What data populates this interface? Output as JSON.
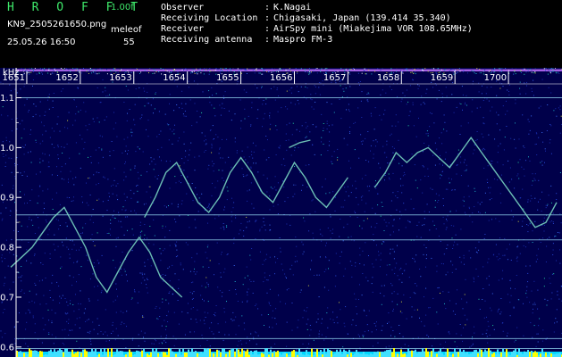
{
  "header": {
    "brand": "H R O F F T",
    "version": "1.00f",
    "filename": "KN9_2505261650.png",
    "datetime": "25.05.26 16:50",
    "meleof_label": "meleof",
    "meteor_count": "55"
  },
  "meta": [
    {
      "label": "Observer",
      "value": "K.Nagai"
    },
    {
      "label": "Receiving Location",
      "value": "Chigasaki, Japan (139.414 35.340)"
    },
    {
      "label": "Receiver",
      "value": "AirSpy mini (Miakejima VOR 108.65MHz)"
    },
    {
      "label": "Receiving antenna",
      "value": "Maspro FM-3"
    }
  ],
  "colors": {
    "background": "#00004a",
    "header_text": "#3ee86a",
    "line": "#9fe8ff",
    "noise_floor": "#ffff00"
  },
  "chart_data": {
    "type": "heatmap",
    "yunit": "kHz",
    "x_ticks": [
      "1651",
      "1652",
      "1653",
      "1654",
      "1655",
      "1656",
      "1657",
      "1658",
      "1659",
      "1700"
    ],
    "y_ticks": [
      "1.1",
      "1.0",
      "0.9",
      "0.8",
      "0.7",
      "0.6"
    ],
    "ylim": [
      0.58,
      1.16
    ],
    "xlim": [
      16.5,
      27.0
    ],
    "horizontal_lines_khz": [
      1.155,
      1.1,
      0.865,
      0.815,
      0.617,
      0.597
    ],
    "traces": [
      {
        "x": [
          16.7,
          16.9,
          17.1,
          17.3,
          17.5,
          17.7,
          17.9,
          18.1,
          18.3,
          18.5,
          18.7,
          18.9,
          19.1,
          19.3,
          19.5,
          19.7,
          19.9
        ],
        "y": [
          0.76,
          0.78,
          0.8,
          0.83,
          0.86,
          0.88,
          0.84,
          0.8,
          0.74,
          0.71,
          0.75,
          0.79,
          0.82,
          0.79,
          0.74,
          0.72,
          0.7
        ]
      },
      {
        "x": [
          19.2,
          19.4,
          19.6,
          19.8,
          20.0,
          20.2,
          20.4,
          20.6,
          20.8,
          21.0,
          21.2,
          21.4,
          21.6,
          21.8,
          22.0,
          22.2,
          22.4,
          22.6,
          22.8,
          23.0
        ],
        "y": [
          0.86,
          0.9,
          0.95,
          0.97,
          0.93,
          0.89,
          0.87,
          0.9,
          0.95,
          0.98,
          0.95,
          0.91,
          0.89,
          0.93,
          0.97,
          0.94,
          0.9,
          0.88,
          0.91,
          0.94
        ]
      },
      {
        "x": [
          23.5,
          23.7,
          23.9,
          24.1,
          24.3,
          24.5,
          24.7,
          24.9,
          25.1,
          25.3,
          25.5,
          25.7,
          25.9,
          26.1,
          26.3,
          26.5,
          26.7,
          26.9
        ],
        "y": [
          0.92,
          0.95,
          0.99,
          0.97,
          0.99,
          1.0,
          0.98,
          0.96,
          0.99,
          1.02,
          0.99,
          0.96,
          0.93,
          0.9,
          0.87,
          0.84,
          0.85,
          0.89
        ]
      },
      {
        "x": [
          21.9,
          22.1,
          22.3
        ],
        "y": [
          1.0,
          1.01,
          1.015
        ]
      }
    ]
  }
}
